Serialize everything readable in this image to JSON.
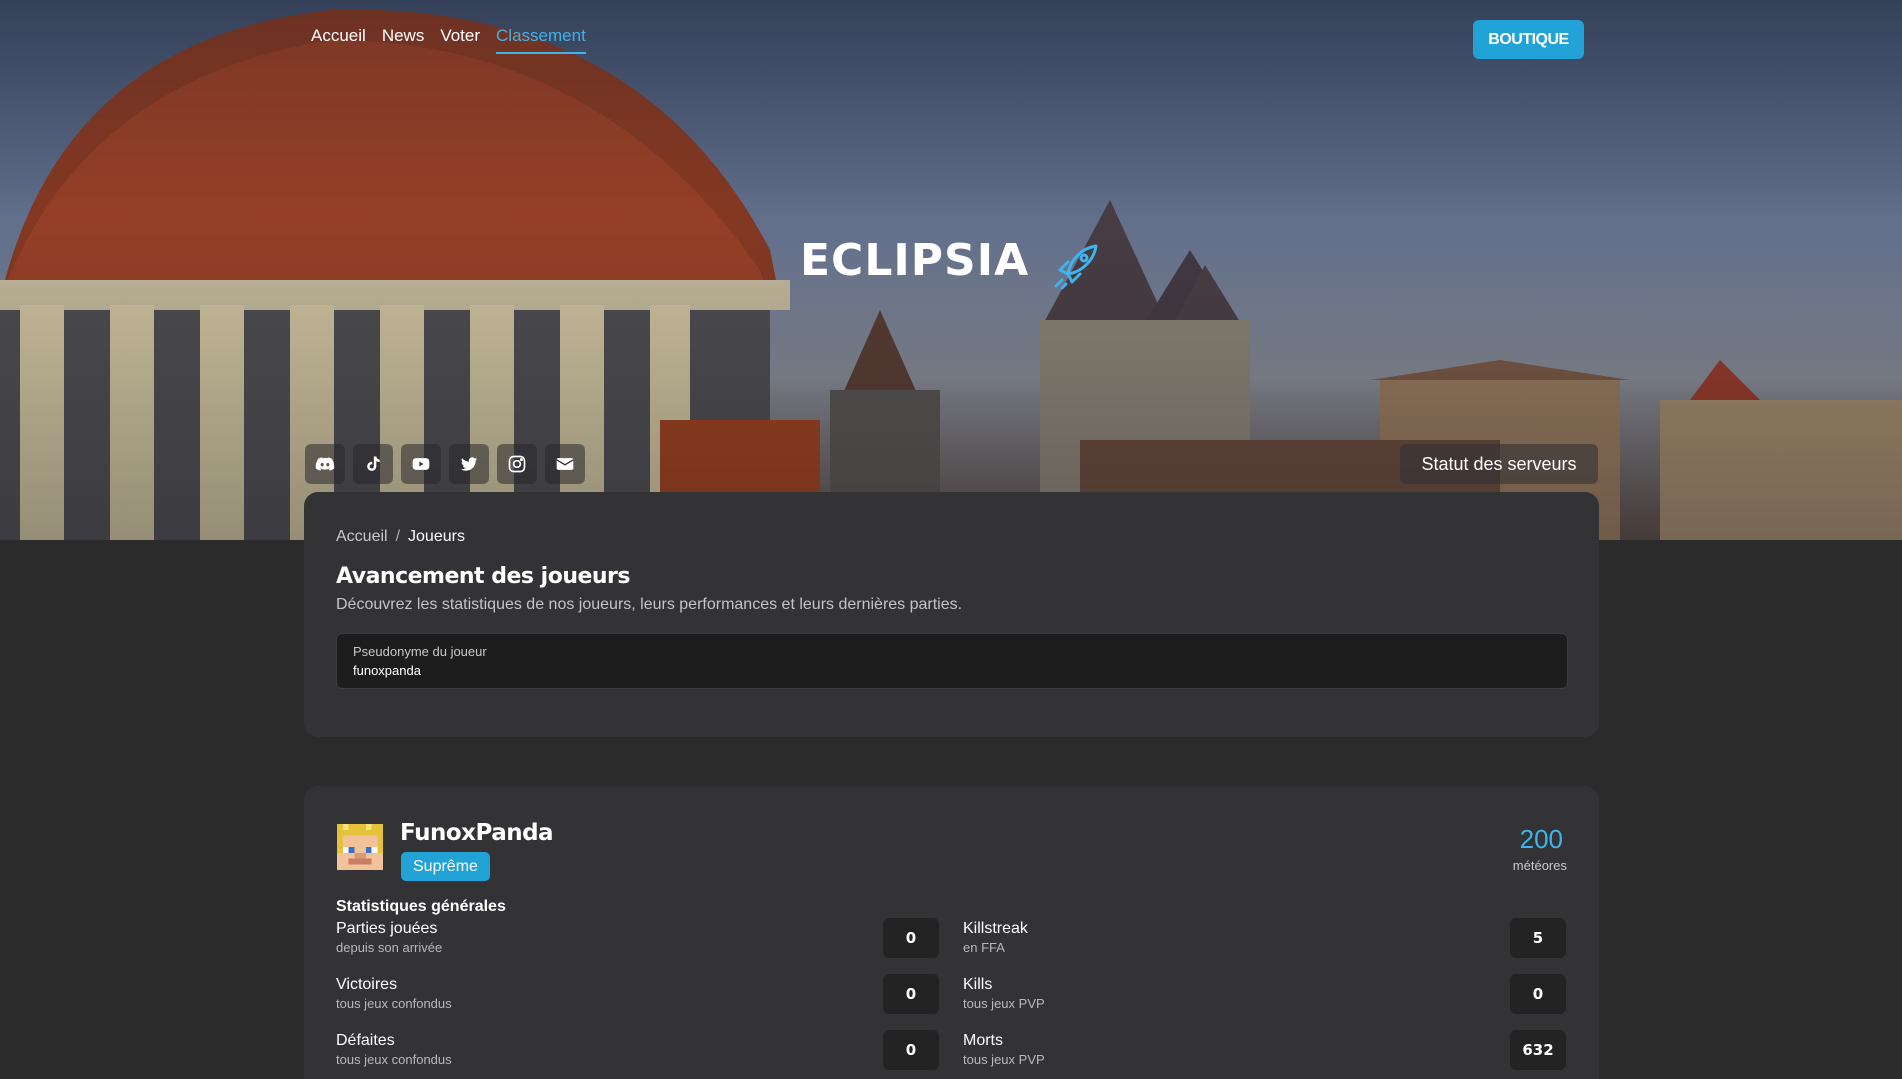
{
  "nav": {
    "items": [
      {
        "label": "Accueil"
      },
      {
        "label": "News"
      },
      {
        "label": "Voter"
      },
      {
        "label": "Classement"
      }
    ],
    "shop_label": "BOUTIQUE"
  },
  "hero": {
    "brand": "ECLIPSIA",
    "socials": [
      "discord-icon",
      "tiktok-icon",
      "youtube-icon",
      "twitter-icon",
      "instagram-icon",
      "mail-icon"
    ],
    "status_label": "Statut des serveurs"
  },
  "page": {
    "breadcrumb": {
      "home": "Accueil",
      "separator": "/",
      "current": "Joueurs"
    },
    "title": "Avancement des joueurs",
    "description": "Découvrez les statistiques de nos joueurs, leurs performances et leurs dernières parties.",
    "search": {
      "label": "Pseudonyme du joueur",
      "value": "funoxpanda"
    }
  },
  "player": {
    "name": "FunoxPanda",
    "rank": "Suprême",
    "meteors_value": "200",
    "meteors_label": "météores",
    "section_title": "Statistiques générales",
    "stats_left": [
      {
        "name": "Parties jouées",
        "sub": "depuis son arrivée",
        "value": "0"
      },
      {
        "name": "Victoires",
        "sub": "tous jeux confondus",
        "value": "0"
      },
      {
        "name": "Défaites",
        "sub": "tous jeux confondus",
        "value": "0"
      }
    ],
    "stats_right": [
      {
        "name": "Killstreak",
        "sub": "en FFA",
        "value": "5"
      },
      {
        "name": "Kills",
        "sub": "tous jeux PVP",
        "value": "0"
      },
      {
        "name": "Morts",
        "sub": "tous jeux PVP",
        "value": "632"
      }
    ]
  },
  "colors": {
    "accent": "#22a3d8",
    "link_active": "#3eb3ec",
    "background": "#2b2b2c",
    "card": "#333335"
  }
}
